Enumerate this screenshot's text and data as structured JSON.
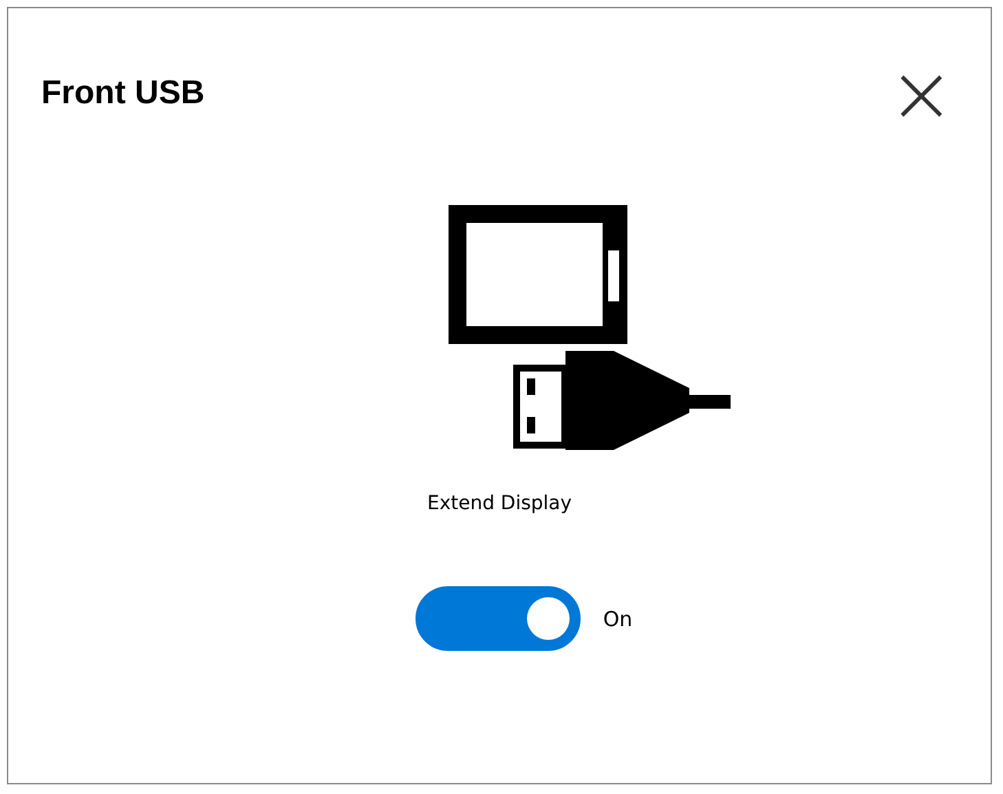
{
  "dialog": {
    "title": "Front USB",
    "close": "×"
  },
  "mode": {
    "label": "Extend Display"
  },
  "toggle": {
    "on": true,
    "label": "On"
  }
}
